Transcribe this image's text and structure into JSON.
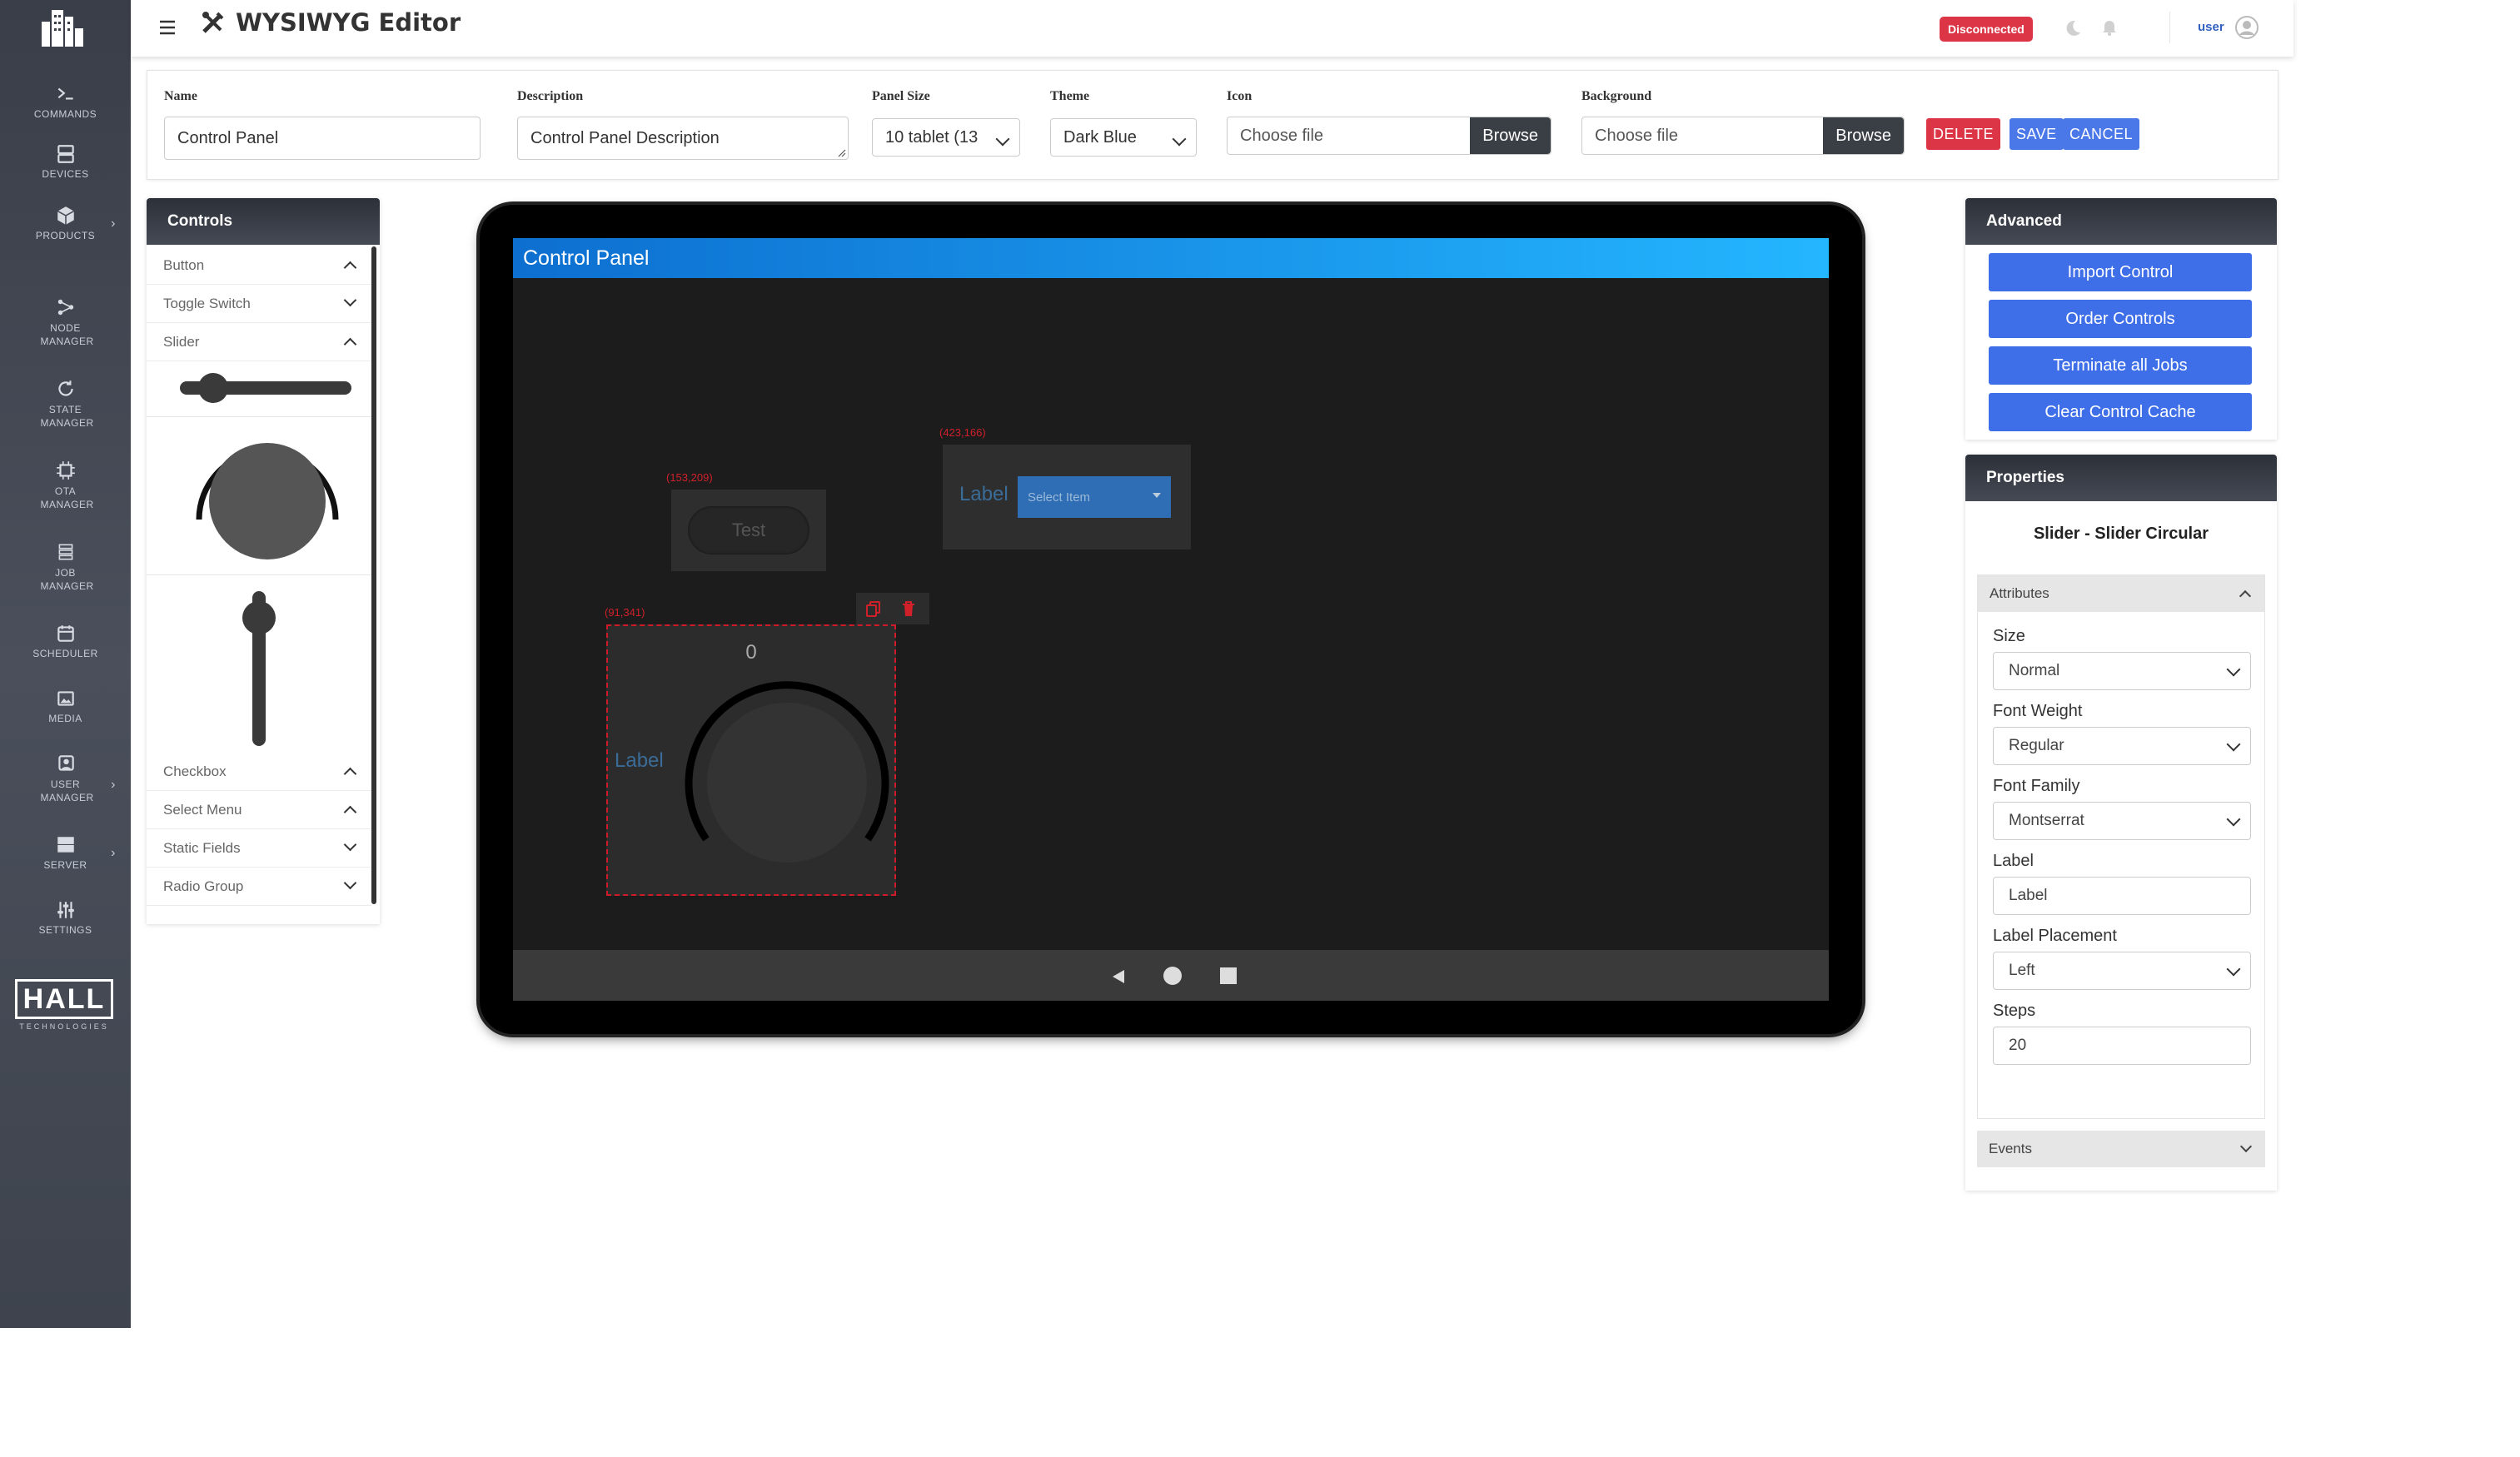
{
  "sidebar": {
    "items": [
      {
        "label": "COMMANDS",
        "icon": "terminal-icon"
      },
      {
        "label": "DEVICES",
        "icon": "server-icon"
      },
      {
        "label": "PRODUCTS",
        "icon": "box-icon"
      },
      {
        "label": "NODE MANAGER",
        "icon": "node-icon"
      },
      {
        "label": "STATE MANAGER",
        "icon": "refresh-icon"
      },
      {
        "label": "OTA MANAGER",
        "icon": "chip-icon"
      },
      {
        "label": "JOB MANAGER",
        "icon": "stack-icon"
      },
      {
        "label": "SCHEDULER",
        "icon": "calendar-icon"
      },
      {
        "label": "MEDIA",
        "icon": "media-icon"
      },
      {
        "label": "USER MANAGER",
        "icon": "users-icon"
      },
      {
        "label": "SERVER",
        "icon": "server-icon"
      },
      {
        "label": "SETTINGS",
        "icon": "sliders-icon"
      }
    ],
    "brand": "HALL",
    "brand_sub": "TECHNOLOGIES"
  },
  "header": {
    "title": "WYSIWYG Editor",
    "status": "Disconnected",
    "user": "user"
  },
  "form": {
    "name_label": "Name",
    "name_value": "Control Panel",
    "description_label": "Description",
    "description_value": "Control Panel Description",
    "panel_size_label": "Panel Size",
    "panel_size_value": "10 tablet (13",
    "theme_label": "Theme",
    "theme_value": "Dark Blue",
    "icon_label": "Icon",
    "icon_placeholder": "Choose file",
    "background_label": "Background",
    "background_placeholder": "Choose file",
    "browse_label": "Browse",
    "delete_label": "DELETE",
    "save_label": "SAVE",
    "cancel_label": "CANCEL"
  },
  "controls": {
    "title": "Controls",
    "items": [
      {
        "label": "Button",
        "state": "expanded"
      },
      {
        "label": "Toggle Switch",
        "state": "collapsed"
      },
      {
        "label": "Slider",
        "state": "expanded"
      },
      {
        "label": "Checkbox",
        "state": "expanded"
      },
      {
        "label": "Select Menu",
        "state": "expanded"
      },
      {
        "label": "Static Fields",
        "state": "collapsed"
      },
      {
        "label": "Radio Group",
        "state": "collapsed"
      }
    ]
  },
  "canvas": {
    "title": "Control Panel",
    "test_coord": "(153,209)",
    "test_label": "Test",
    "select_coord": "(423,166)",
    "select_label": "Label",
    "select_placeholder": "Select Item",
    "knob_coord": "(91,341)",
    "knob_value": "0",
    "knob_label": "Label"
  },
  "advanced": {
    "title": "Advanced",
    "buttons": [
      "Import Control",
      "Order Controls",
      "Terminate all Jobs",
      "Clear Control Cache"
    ]
  },
  "properties": {
    "title": "Properties",
    "subtitle": "Slider - Slider Circular",
    "attributes_label": "Attributes",
    "events_label": "Events",
    "size_label": "Size",
    "size_value": "Normal",
    "font_weight_label": "Font Weight",
    "font_weight_value": "Regular",
    "font_family_label": "Font Family",
    "font_family_value": "Montserrat",
    "label_label": "Label",
    "label_value": "Label",
    "label_placement_label": "Label Placement",
    "label_placement_value": "Left",
    "steps_label": "Steps",
    "steps_value": "20"
  },
  "colors": {
    "accent": "#3f6fe8",
    "danger": "#dc3545",
    "header_gradient_start": "#0d6fd0",
    "header_gradient_end": "#24b6ff"
  }
}
